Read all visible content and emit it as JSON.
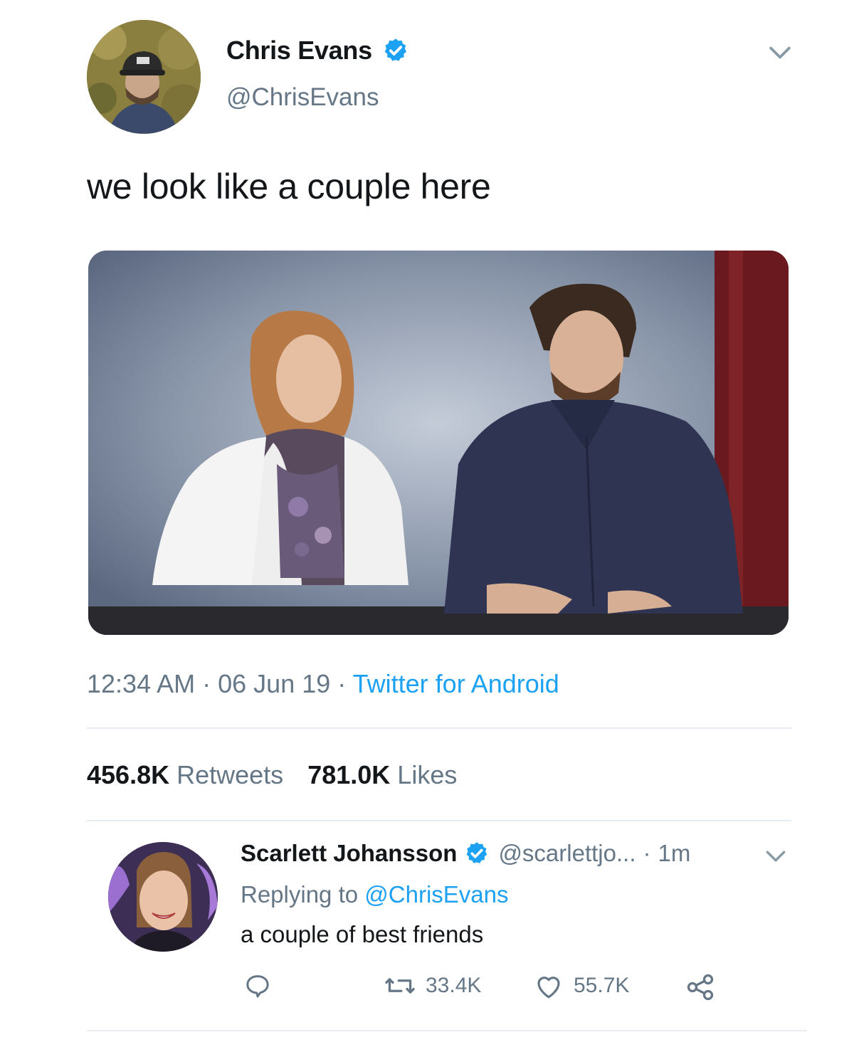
{
  "main_tweet": {
    "display_name": "Chris Evans",
    "handle": "@ChrisEvans",
    "text": "we look like a couple here",
    "time": "12:34 AM",
    "date": "06 Jun 19",
    "source": "Twitter for Android",
    "retweets_count": "456.8K",
    "retweets_label": "Retweets",
    "likes_count": "781.0K",
    "likes_label": "Likes"
  },
  "reply": {
    "display_name": "Scarlett Johansson",
    "handle": "@scarlettjo...",
    "time": "1m",
    "replying_prefix": "Replying to",
    "replying_to": "@ChrisEvans",
    "text": "a couple of best friends",
    "retweet_count": "33.4K",
    "like_count": "55.7K"
  },
  "icons": {
    "verified": "verified-badge-icon",
    "chevron": "chevron-down-icon",
    "reply": "reply-icon",
    "retweet": "retweet-icon",
    "like": "heart-icon",
    "share": "share-icon"
  },
  "colors": {
    "accent": "#1da1f2",
    "secondary_text": "#657786",
    "primary_text": "#14171a",
    "divider": "#e6ecf0"
  }
}
